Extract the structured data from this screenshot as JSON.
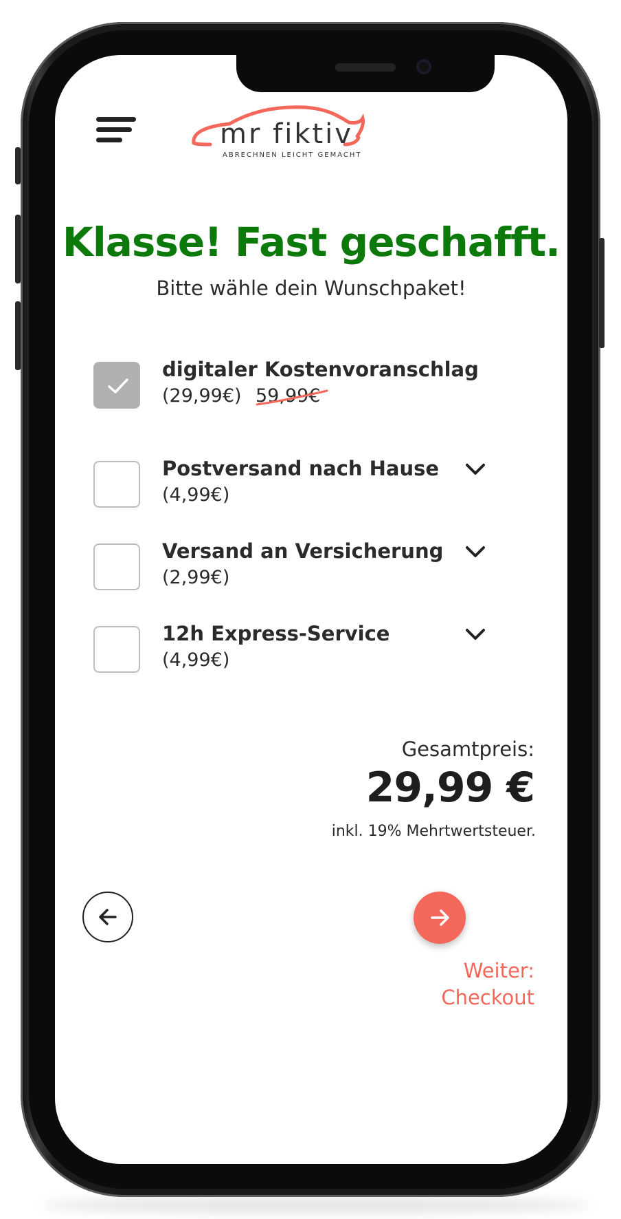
{
  "brand": {
    "name": "mr fiktiv",
    "tagline": "ABRECHNEN LEICHT GEMACHT",
    "accent_color": "#f4675b",
    "headline_color": "#0b7a0b"
  },
  "header": {
    "menu_icon": "hamburger-menu-icon"
  },
  "main": {
    "headline": "Klasse! Fast geschafft.",
    "subline": "Bitte wähle dein Wunschpaket!"
  },
  "options": [
    {
      "title": "digitaler Kostenvoranschlag",
      "price": "(29,99€)",
      "old_price": "59,99€",
      "checked": true
    },
    {
      "title": "Postversand nach Hause",
      "price": "(4,99€)",
      "checked": false
    },
    {
      "title": "Versand an Versicherung",
      "price": "(2,99€)",
      "checked": false
    },
    {
      "title": "12h Express-Service",
      "price": "(4,99€)",
      "checked": false
    }
  ],
  "total": {
    "label": "Gesamtpreis:",
    "value": "29,99 €",
    "vat_note": "inkl. 19% Mehrtwertsteuer."
  },
  "navigation": {
    "back_icon": "arrow-left-icon",
    "next_icon": "arrow-right-icon",
    "next_label_line1": "Weiter:",
    "next_label_line2": "Checkout"
  }
}
